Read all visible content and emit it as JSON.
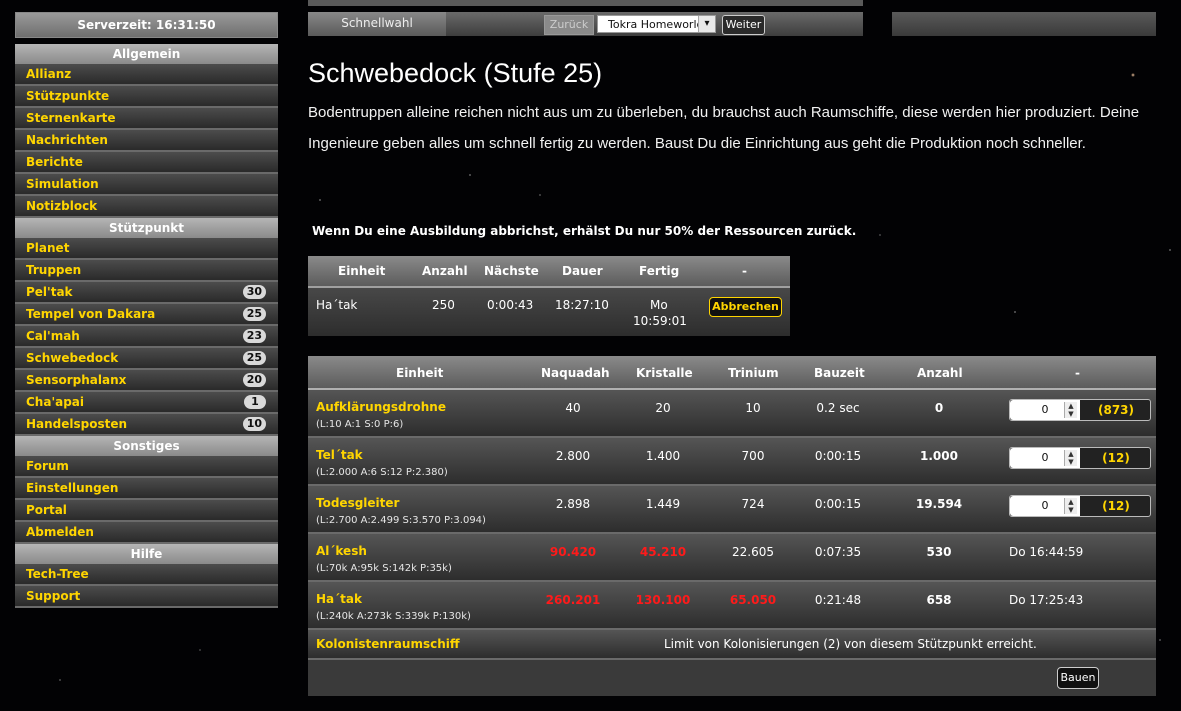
{
  "sidebar": {
    "servertime": "Serverzeit: 16:31:50",
    "sections": [
      {
        "title": "Allgemein",
        "items": [
          {
            "label": "Allianz"
          },
          {
            "label": "Stützpunkte"
          },
          {
            "label": "Sternenkarte"
          },
          {
            "label": "Nachrichten"
          },
          {
            "label": "Berichte"
          },
          {
            "label": "Simulation"
          },
          {
            "label": "Notizblock"
          }
        ]
      },
      {
        "title": "Stützpunkt",
        "items": [
          {
            "label": "Planet"
          },
          {
            "label": "Truppen"
          },
          {
            "label": "Pel'tak",
            "badge": "30"
          },
          {
            "label": "Tempel von Dakara",
            "badge": "25"
          },
          {
            "label": "Cal'mah",
            "badge": "23"
          },
          {
            "label": "Schwebedock",
            "badge": "25"
          },
          {
            "label": "Sensorphalanx",
            "badge": "20"
          },
          {
            "label": "Cha'apai",
            "badge": "1"
          },
          {
            "label": "Handelsposten",
            "badge": "10"
          }
        ]
      },
      {
        "title": "Sonstiges",
        "items": [
          {
            "label": "Forum"
          },
          {
            "label": "Einstellungen"
          },
          {
            "label": "Portal"
          },
          {
            "label": "Abmelden"
          }
        ]
      },
      {
        "title": "Hilfe",
        "items": [
          {
            "label": "Tech-Tree"
          },
          {
            "label": "Support"
          }
        ]
      }
    ]
  },
  "topbar": {
    "quickselect": "Schnellwahl",
    "back": "Zurück",
    "planet": "Tokra Homeworld",
    "next": "Weiter"
  },
  "page": {
    "title": "Schwebedock (Stufe 25)",
    "description": "Bodentruppen alleine reichen nicht aus um zu überleben, du brauchst auch Raumschiffe, diese werden hier produziert. Deine Ingenieure geben alles um schnell fertig zu werden. Baust Du die Einrichtung aus geht die Produktion noch schneller.",
    "warning": "Wenn Du eine Ausbildung abbrichst, erhälst Du nur 50% der Ressourcen zurück."
  },
  "queue": {
    "headers": [
      "Einheit",
      "Anzahl",
      "Nächste",
      "Dauer",
      "Fertig",
      "-"
    ],
    "row": {
      "unit": "Ha´tak",
      "count": "250",
      "next": "0:00:43",
      "duration": "18:27:10",
      "done1": "Mo",
      "done2": "10:59:01",
      "action": "Abbrechen"
    }
  },
  "production": {
    "headers": [
      "Einheit",
      "Naquadah",
      "Kristalle",
      "Trinium",
      "Bauzeit",
      "Anzahl",
      "-"
    ],
    "rows": [
      {
        "name": "Aufklärungsdrohne",
        "stats": "(L:10 A:1 S:0 P:6)",
        "naq": "40",
        "kri": "20",
        "tri": "10",
        "time": "0.2 sec",
        "count": "0",
        "input": "0",
        "max": "(873)"
      },
      {
        "name": "Tel´tak",
        "stats": "(L:2.000 A:6 S:12 P:2.380)",
        "naq": "2.800",
        "kri": "1.400",
        "tri": "700",
        "time": "0:00:15",
        "count": "1.000",
        "input": "0",
        "max": "(12)"
      },
      {
        "name": "Todesgleiter",
        "stats": "(L:2.700 A:2.499 S:3.570 P:3.094)",
        "naq": "2.898",
        "kri": "1.449",
        "tri": "724",
        "time": "0:00:15",
        "count": "19.594",
        "input": "0",
        "max": "(12)"
      },
      {
        "name": "Al´kesh",
        "stats": "(L:70k A:95k S:142k P:35k)",
        "naq": "90.420",
        "kri": "45.210",
        "tri": "22.605",
        "time": "0:07:35",
        "count": "530",
        "done": "Do 16:44:59"
      },
      {
        "name": "Ha´tak",
        "stats": "(L:240k A:273k S:339k P:130k)",
        "naq": "260.201",
        "kri": "130.100",
        "tri": "65.050",
        "time": "0:21:48",
        "count": "658",
        "done": "Do 17:25:43"
      }
    ],
    "colonist": {
      "name": "Kolonistenraumschiff",
      "note": "Limit von Kolonisierungen (2) von diesem Stützpunkt erreicht."
    },
    "build": "Bauen"
  },
  "colors": {
    "accent": "#ffd500",
    "insufficient": "#ff1a1a"
  }
}
